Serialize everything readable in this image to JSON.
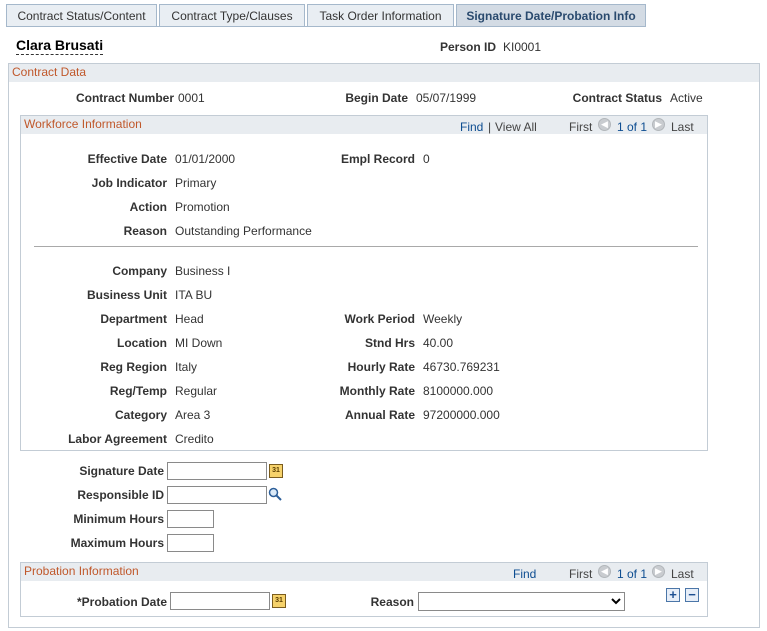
{
  "tabs": [
    {
      "label": "Contract Status/Content"
    },
    {
      "label": "Contract Type/Clauses"
    },
    {
      "label": "Task Order Information"
    },
    {
      "label": "Signature Date/Probation Info"
    }
  ],
  "header": {
    "person_name": "Clara Brusati",
    "person_id_label": "Person ID",
    "person_id": "KI0001"
  },
  "contract": {
    "section_title": "Contract Data",
    "contract_number_label": "Contract Number",
    "contract_number": "0001",
    "begin_date_label": "Begin Date",
    "begin_date": "05/07/1999",
    "contract_status_label": "Contract Status",
    "contract_status": "Active"
  },
  "workforce": {
    "section_title": "Workforce Information",
    "find": "Find",
    "view_all": "View All",
    "separator": "|",
    "first": "First",
    "counter": "1 of 1",
    "last": "Last",
    "effective_date_label": "Effective Date",
    "effective_date": "01/01/2000",
    "empl_record_label": "Empl Record",
    "empl_record": "0",
    "job_indicator_label": "Job Indicator",
    "job_indicator": "Primary",
    "action_label": "Action",
    "action": "Promotion",
    "reason_label": "Reason",
    "reason": "Outstanding Performance",
    "company_label": "Company",
    "company": "Business I",
    "business_unit_label": "Business Unit",
    "business_unit": "ITA BU",
    "department_label": "Department",
    "department": "Head",
    "location_label": "Location",
    "location": "MI Down",
    "reg_region_label": "Reg Region",
    "reg_region": "Italy",
    "reg_temp_label": "Reg/Temp",
    "reg_temp": "Regular",
    "category_label": "Category",
    "category": "Area 3",
    "labor_agreement_label": "Labor Agreement",
    "labor_agreement": "Credito",
    "work_period_label": "Work Period",
    "work_period": "Weekly",
    "stnd_hrs_label": "Stnd Hrs",
    "stnd_hrs": "40.00",
    "hourly_rate_label": "Hourly Rate",
    "hourly_rate": "46730.769231",
    "monthly_rate_label": "Monthly Rate",
    "monthly_rate": "8100000.000",
    "annual_rate_label": "Annual Rate",
    "annual_rate": "97200000.000"
  },
  "signature": {
    "signature_date_label": "Signature Date",
    "signature_date": "",
    "responsible_id_label": "Responsible ID",
    "responsible_id": "",
    "minimum_hours_label": "Minimum Hours",
    "minimum_hours": "",
    "maximum_hours_label": "Maximum Hours",
    "maximum_hours": ""
  },
  "probation": {
    "section_title": "Probation Information",
    "find": "Find",
    "first": "First",
    "counter": "1 of 1",
    "last": "Last",
    "probation_date_label": "*Probation Date",
    "probation_date": "",
    "reason_label": "Reason",
    "reason_selected": ""
  },
  "icons": {
    "calendar": "calendar-icon",
    "lookup": "magnifier-icon",
    "add": "+",
    "delete": "−",
    "prev": "◀",
    "next": "▶"
  }
}
